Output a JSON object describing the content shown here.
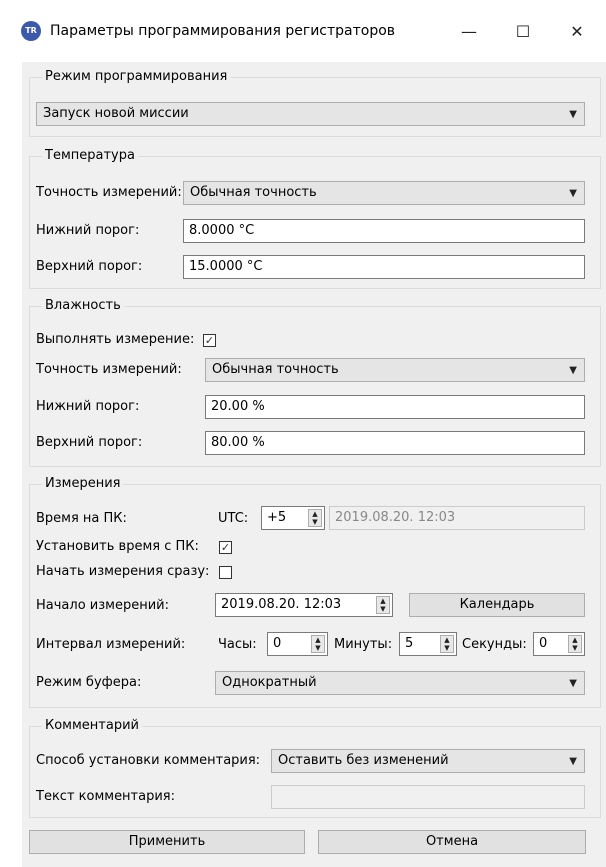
{
  "window": {
    "title": "Параметры программирования регистраторов",
    "icon_text": "TR",
    "minimize": "—",
    "maximize": "☐",
    "close": "✕"
  },
  "programming": {
    "legend": "Режим программирования",
    "mode": "Запуск новой миссии"
  },
  "temperature": {
    "legend": "Температура",
    "accuracy_label": "Точность измерений:",
    "accuracy": "Обычная точность",
    "low_label": "Нижний порог:",
    "low": "8.0000 °C",
    "high_label": "Верхний порог:",
    "high": "15.0000 °C"
  },
  "humidity": {
    "legend": "Влажность",
    "measure_label": "Выполнять измерение:",
    "measure_checked": true,
    "accuracy_label": "Точность измерений:",
    "accuracy": "Обычная точность",
    "low_label": "Нижний порог:",
    "low": "20.00 %",
    "high_label": "Верхний порог:",
    "high": "80.00 %"
  },
  "measurements": {
    "legend": "Измерения",
    "pc_time_label": "Время на ПК:",
    "utc_label": "UTC:",
    "utc_offset": "+5",
    "pc_time": "2019.08.20. 12:03",
    "set_time_label": "Установить время с ПК:",
    "set_time_checked": true,
    "start_now_label": "Начать измерения сразу:",
    "start_now_checked": false,
    "start_label": "Начало измерений:",
    "start": "2019.08.20. 12:03",
    "calendar_button": "Календарь",
    "interval_label": "Интервал измерений:",
    "hours_label": "Часы:",
    "hours": "0",
    "minutes_label": "Минуты:",
    "minutes": "5",
    "seconds_label": "Секунды:",
    "seconds": "0",
    "buffer_label": "Режим буфера:",
    "buffer": "Однократный"
  },
  "comment": {
    "legend": "Комментарий",
    "method_label": "Способ установки комментария:",
    "method": "Оставить без изменений",
    "text_label": "Текст комментария:",
    "text": ""
  },
  "buttons": {
    "apply": "Применить",
    "cancel": "Отмена"
  }
}
